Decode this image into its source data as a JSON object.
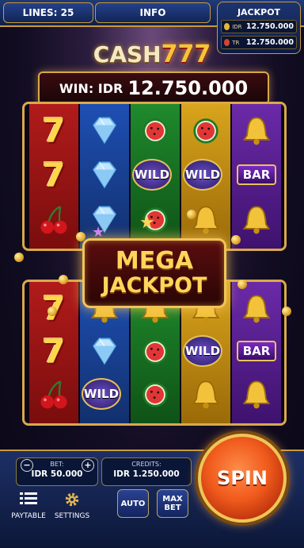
{
  "top_bar": {
    "lines_label": "LINES: 25",
    "info_label": "INFO"
  },
  "jackpot": {
    "title": "JACKPOT",
    "rows": [
      {
        "currency": "IDR",
        "value": "12.750.000"
      },
      {
        "currency": "TR",
        "value": "12.750.000"
      }
    ]
  },
  "logo": {
    "part1": "CASH",
    "part2": "777"
  },
  "win": {
    "label": "WIN: IDR",
    "amount": "12.750.000"
  },
  "reels_top": [
    [
      "seven",
      "seven",
      "cherry"
    ],
    [
      "diamond",
      "diamond",
      "diamond"
    ],
    [
      "watermelon",
      "wild",
      "watermelon"
    ],
    [
      "watermelon",
      "wild",
      "bell"
    ],
    [
      "bell",
      "bar",
      "bell"
    ]
  ],
  "reels_bottom": [
    [
      "seven",
      "seven",
      "cherry"
    ],
    [
      "bell",
      "diamond",
      "wild"
    ],
    [
      "bell",
      "watermelon",
      "watermelon"
    ],
    [
      "bell",
      "wild",
      "bell"
    ],
    [
      "bell",
      "bar",
      "bell"
    ]
  ],
  "symbols": {
    "wild_label": "WILD",
    "bar_label": "BAR",
    "seven_label": "7"
  },
  "mega_jackpot": {
    "line1": "MEGA",
    "line2": "JACKPOT"
  },
  "bet": {
    "label": "BET:",
    "value": "IDR 50.000"
  },
  "credits": {
    "label": "CREDITS:",
    "value": "IDR 1.250.000"
  },
  "buttons": {
    "paytable": "PAYTABLE",
    "settings": "SETTINGS",
    "auto": "AUTO",
    "max_bet_line1": "MAX",
    "max_bet_line2": "BET",
    "spin": "SPIN",
    "minus": "−",
    "plus": "+"
  },
  "colors": {
    "gold": "#d9a94c",
    "spin": "#f05a1c"
  }
}
